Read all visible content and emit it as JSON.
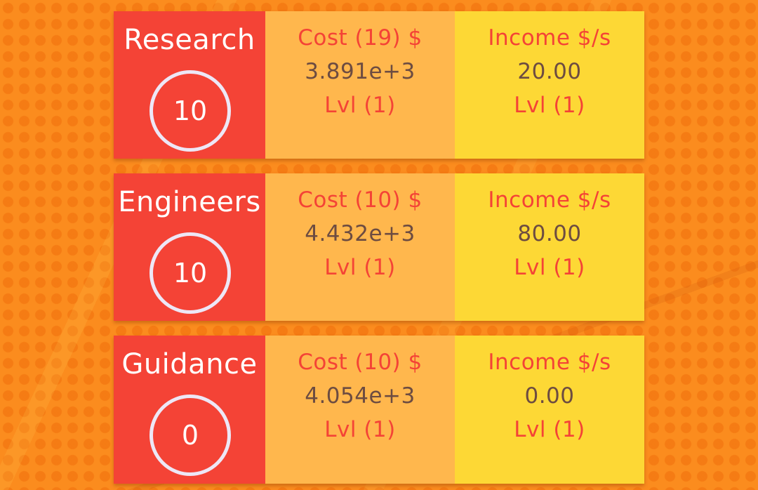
{
  "upgrades": [
    {
      "name": "Research",
      "count": "10",
      "cost_label": "Cost (19) $",
      "cost_value": "3.891e+3",
      "cost_level": "Lvl (1)",
      "income_label": "Income $/s",
      "income_value": "20.00",
      "income_level": "Lvl (1)"
    },
    {
      "name": "Engineers",
      "count": "10",
      "cost_label": "Cost (10) $",
      "cost_value": "4.432e+3",
      "cost_level": "Lvl (1)",
      "income_label": "Income $/s",
      "income_value": "80.00",
      "income_level": "Lvl (1)"
    },
    {
      "name": "Guidance",
      "count": "0",
      "cost_label": "Cost (10) $",
      "cost_value": "4.054e+3",
      "cost_level": "Lvl (1)",
      "income_label": "Income $/s",
      "income_value": "0.00",
      "income_level": "Lvl (1)"
    }
  ],
  "colors": {
    "background": "#fb8c1e",
    "name_panel": "#f44336",
    "cost_panel": "#ffb74d",
    "income_panel": "#fdd835",
    "accent_text": "#f44336",
    "value_text": "#6d4c41",
    "circle_border": "#ede7f6"
  }
}
